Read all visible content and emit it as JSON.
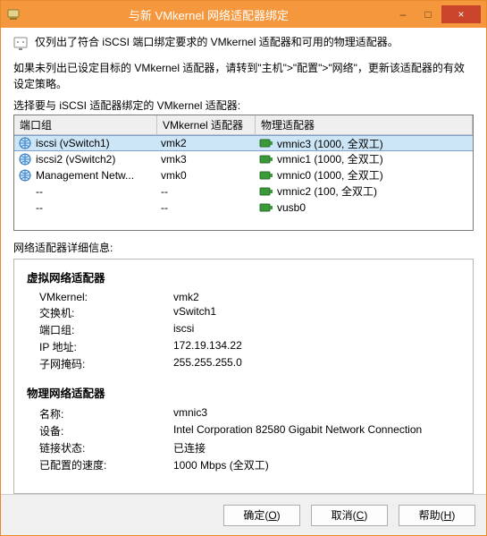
{
  "window": {
    "title": "与新 VMkernel 网络适配器绑定",
    "minimize": "–",
    "maximize": "□",
    "close": "×"
  },
  "intro": "仅列出了符合 iSCSI 端口绑定要求的 VMkernel 适配器和可用的物理适配器。",
  "instruction": "如果未列出已设定目标的 VMkernel 适配器，请转到\"主机\">\"配置\">\"网络\"，更新该适配器的有效设定策略。",
  "table_label": "选择要与 iSCSI 适配器绑定的 VMkernel 适配器:",
  "columns": {
    "portgroup": "端口组",
    "vmk": "VMkernel 适配器",
    "phys": "物理适配器"
  },
  "rows": [
    {
      "pg": "iscsi (vSwitch1)",
      "vmk": "vmk2",
      "phys": "vmnic3 (1000, 全双工)",
      "selected": true,
      "pgicon": "globe",
      "physicon": "nic"
    },
    {
      "pg": "iscsi2 (vSwitch2)",
      "vmk": "vmk3",
      "phys": "vmnic1 (1000, 全双工)",
      "selected": false,
      "pgicon": "globe",
      "physicon": "nic"
    },
    {
      "pg": "Management Netw...",
      "vmk": "vmk0",
      "phys": "vmnic0 (1000, 全双工)",
      "selected": false,
      "pgicon": "globe",
      "physicon": "nic"
    },
    {
      "pg": "--",
      "vmk": "--",
      "phys": "vmnic2 (100, 全双工)",
      "selected": false,
      "pgicon": "",
      "physicon": "nic"
    },
    {
      "pg": "--",
      "vmk": "--",
      "phys": "vusb0",
      "selected": false,
      "pgicon": "",
      "physicon": "nic"
    }
  ],
  "details_label": "网络适配器详细信息:",
  "details": {
    "virtual_head": "虚拟网络适配器",
    "virtual": {
      "vmkernel_k": "VMkernel:",
      "vmkernel_v": "vmk2",
      "switch_k": "交换机:",
      "switch_v": "vSwitch1",
      "portgroup_k": "端口组:",
      "portgroup_v": "iscsi",
      "ip_k": "IP 地址:",
      "ip_v": "172.19.134.22",
      "mask_k": "子网掩码:",
      "mask_v": "255.255.255.0"
    },
    "physical_head": "物理网络适配器",
    "physical": {
      "name_k": "名称:",
      "name_v": "vmnic3",
      "device_k": "设备:",
      "device_v": "Intel Corporation 82580 Gigabit Network Connection",
      "link_k": "链接状态:",
      "link_v": "已连接",
      "speed_k": "已配置的速度:",
      "speed_v": "1000 Mbps (全双工)"
    }
  },
  "buttons": {
    "ok_pre": "确定(",
    "ok_u": "O",
    "ok_post": ")",
    "cancel_pre": "取消(",
    "cancel_u": "C",
    "cancel_post": ")",
    "help_pre": "帮助(",
    "help_u": "H",
    "help_post": ")"
  }
}
